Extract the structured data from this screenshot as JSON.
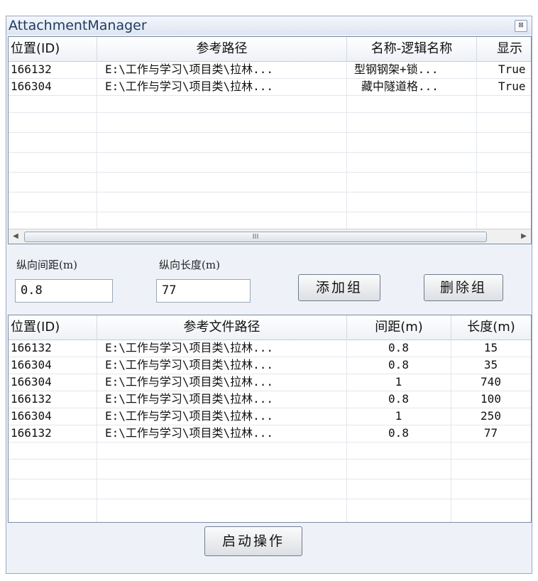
{
  "window": {
    "title": "AttachmentManager",
    "close_icon": "close-icon"
  },
  "top_table": {
    "columns": [
      "位置(ID)",
      "参考路径",
      "名称-逻辑名称",
      "显示"
    ],
    "rows": [
      [
        "166132",
        "E:\\工作与学习\\项目类\\拉林...",
        "型钢钢架+锁...",
        "True"
      ],
      [
        "166304",
        "E:\\工作与学习\\项目类\\拉林...",
        "藏中隧道格...",
        "True"
      ]
    ],
    "scroll_grip": "III"
  },
  "form": {
    "spacing_label": "纵向间距(m)",
    "spacing_value": "0.8",
    "length_label": "纵向长度(m)",
    "length_value": "77",
    "add_group": "添加组",
    "delete_group": "删除组"
  },
  "bottom_table": {
    "columns": [
      "位置(ID)",
      "参考文件路径",
      "间距(m)",
      "长度(m)"
    ],
    "rows": [
      [
        "166132",
        "E:\\工作与学习\\项目类\\拉林...",
        "0.8",
        "15"
      ],
      [
        "166304",
        "E:\\工作与学习\\项目类\\拉林...",
        "0.8",
        "35"
      ],
      [
        "166304",
        "E:\\工作与学习\\项目类\\拉林...",
        "1",
        "740"
      ],
      [
        "166132",
        "E:\\工作与学习\\项目类\\拉林...",
        "0.8",
        "100"
      ],
      [
        "166304",
        "E:\\工作与学习\\项目类\\拉林...",
        "1",
        "250"
      ],
      [
        "166132",
        "E:\\工作与学习\\项目类\\拉林...",
        "0.8",
        "77"
      ]
    ]
  },
  "start_button": "启动操作"
}
